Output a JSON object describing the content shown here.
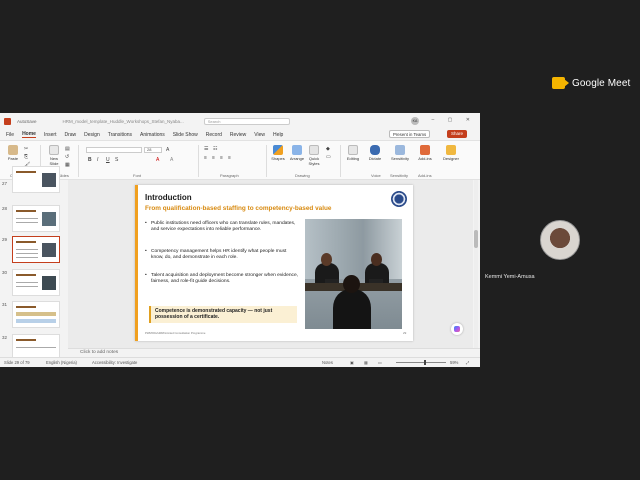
{
  "meet": {
    "logo_text": "Google Meet"
  },
  "participant": {
    "name": "Kemmi Yemi-Amusa"
  },
  "powerpoint": {
    "titlebar": {
      "autosave": "AutoSave",
      "file_name": "HRM_model_template_Huddle_Workshops_Stefan_Nyaba...",
      "search_placeholder": "Search",
      "user_initials": "KA"
    },
    "tabs": [
      "File",
      "Home",
      "Insert",
      "Draw",
      "Design",
      "Transitions",
      "Animations",
      "Slide Show",
      "Record",
      "Review",
      "View",
      "Help"
    ],
    "active_tab": "Home",
    "present_label": "Present in Teams",
    "share_label": "Share",
    "ribbon": {
      "paste": "Paste",
      "new_slide": "New Slide",
      "shapes": "Shapes",
      "arrange": "Arrange",
      "quick_styles": "Quick Styles",
      "editing": "Editing",
      "dictate": "Dictate",
      "sensitivity": "Sensitivity",
      "addins": "Add-ins",
      "designer": "Designer",
      "font_size": "28",
      "groups": {
        "clipboard": "Clipboard",
        "slides": "Slides",
        "font": "Font",
        "paragraph": "Paragraph",
        "drawing": "Drawing",
        "voice": "Voice",
        "sensitivity": "Sensitivity",
        "addins": "Add-ins"
      }
    },
    "thumb_numbers": [
      "27",
      "28",
      "29",
      "30",
      "31",
      "32"
    ],
    "selected_slide": "29",
    "slide": {
      "title": "Introduction",
      "subtitle": "From qualification-based staffing to competency-based value",
      "bullets": [
        "Public institutions need officers who can translate rules, mandates, and service expectations into reliable performance.",
        "Competency management helps HR identify what people must know, do, and demonstrate in each role.",
        "Talent acquisition and deployment become stronger when evidence, fairness, and role-fit guide decisions."
      ],
      "callout": "Competence is demonstrated capacity — not just possession of a certificate.",
      "footer": "PWM/DG/HRM/Limited Consultation Programme",
      "page": "29"
    },
    "notes_placeholder": "Click to add notes",
    "status": {
      "slide_of": "Slide 29 of 79",
      "language": "English (Nigeria)",
      "accessibility": "Accessibility: Investigate",
      "notes": "Notes",
      "zoom": "59%"
    }
  }
}
